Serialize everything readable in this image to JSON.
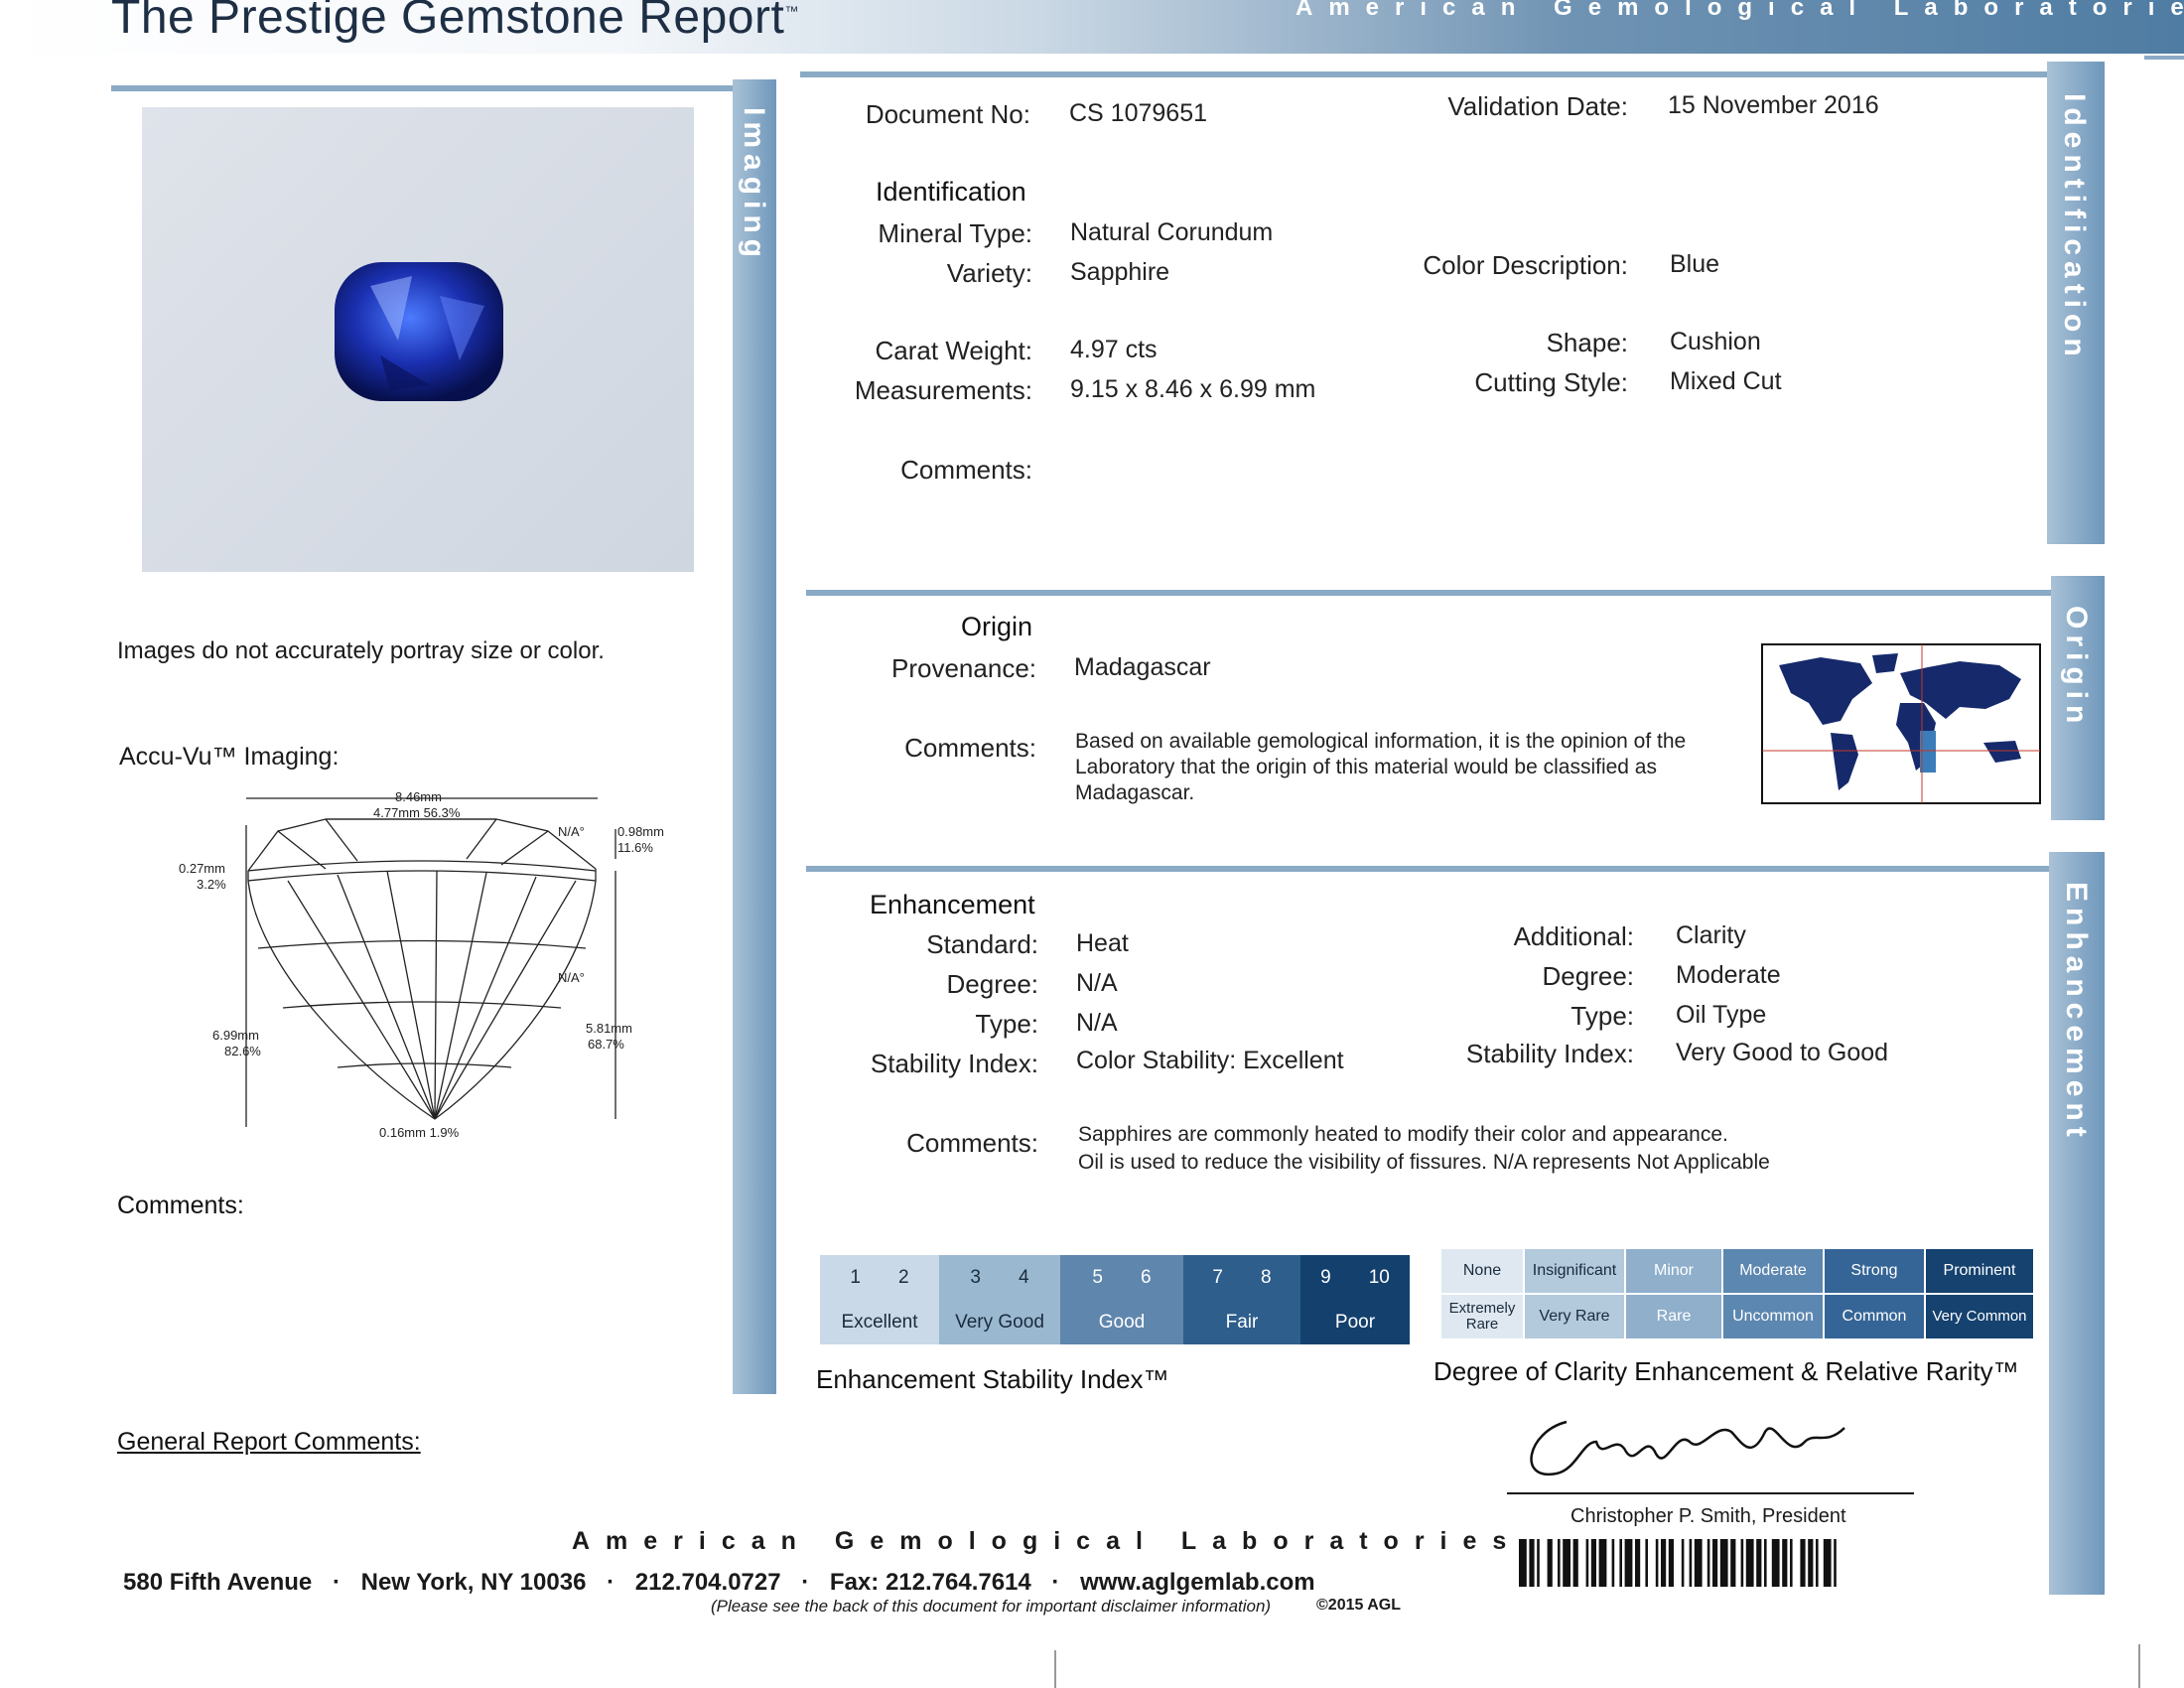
{
  "header": {
    "title": "The Prestige Gemstone Report",
    "title_mark": "™",
    "lab_name": "American Gemological Laboratories"
  },
  "imaging": {
    "tab_label": "Imaging",
    "image_note": "Images do not accurately portray size or color.",
    "accu_vu_label": "Accu-Vu™ Imaging:",
    "diagram": {
      "width": "8.46mm",
      "table": "4.77mm 56.3%",
      "crown_angle": "N/A°",
      "crown_height_mm": "0.98mm",
      "crown_height_pct": "11.6%",
      "girdle_mm": "0.27mm",
      "girdle_pct": "3.2%",
      "pavilion_angle": "N/A°",
      "depth_mm": "6.99mm",
      "depth_pct": "82.6%",
      "pavilion_depth_mm": "5.81mm",
      "pavilion_depth_pct": "68.7%",
      "culet": "0.16mm 1.9%"
    },
    "comments_label": "Comments:"
  },
  "identification": {
    "tab_label": "Identification",
    "document_no_label": "Document No:",
    "document_no": "CS 1079651",
    "validation_date_label": "Validation Date:",
    "validation_date": "15 November 2016",
    "section_title": "Identification",
    "mineral_type_label": "Mineral Type:",
    "mineral_type": "Natural Corundum",
    "variety_label": "Variety:",
    "variety": "Sapphire",
    "color_description_label": "Color Description:",
    "color_description": "Blue",
    "carat_weight_label": "Carat Weight:",
    "carat_weight": "4.97  cts",
    "shape_label": "Shape:",
    "shape": "Cushion",
    "measurements_label": "Measurements:",
    "measurements": "9.15 x 8.46 x 6.99  mm",
    "cutting_style_label": "Cutting Style:",
    "cutting_style": "Mixed Cut",
    "comments_label": "Comments:"
  },
  "origin": {
    "tab_label": "Origin",
    "section_title": "Origin",
    "provenance_label": "Provenance:",
    "provenance": "Madagascar",
    "comments_label": "Comments:",
    "comments": "Based on available gemological information, it is the opinion of the Laboratory that the origin of this material would be classified as Madagascar."
  },
  "enhancement": {
    "tab_label": "Enhancement",
    "section_title": "Enhancement",
    "standard_label": "Standard:",
    "standard": "Heat",
    "degree_label": "Degree:",
    "degree": "N/A",
    "type_label": "Type:",
    "type": "N/A",
    "stability_label": "Stability Index:",
    "stability": "Color Stability: Excellent",
    "additional_label": "Additional:",
    "additional": "Clarity",
    "add_degree_label": "Degree:",
    "add_degree": "Moderate",
    "add_type_label": "Type:",
    "add_type": "Oil Type",
    "add_stability_label": "Stability Index:",
    "add_stability": "Very Good to Good",
    "comments_label": "Comments:",
    "comments_line1": "Sapphires are commonly heated to modify their color and appearance.",
    "comments_line2": "Oil is used to reduce the visibility of fissures. N/A represents Not Applicable"
  },
  "stability_scale": {
    "title": "Enhancement Stability Index™",
    "numbers": [
      "1",
      "2",
      "3",
      "4",
      "5",
      "6",
      "7",
      "8",
      "9",
      "10"
    ],
    "grades": [
      "Excellent",
      "Very Good",
      "Good",
      "Fair",
      "Poor"
    ],
    "colors": [
      "#c9d9e7",
      "#9bb8d1",
      "#5f86ad",
      "#2e5e8c",
      "#14406e"
    ]
  },
  "clarity_scale": {
    "title": "Degree of Clarity Enhancement & Relative Rarity™",
    "degrees": [
      "None",
      "Insignificant",
      "Minor",
      "Moderate",
      "Strong",
      "Prominent"
    ],
    "rarity": [
      "Extremely Rare",
      "Very Rare",
      "Rare",
      "Uncommon",
      "Common",
      "Very Common"
    ],
    "colors": [
      "#dfe8f1",
      "#b3c9dc",
      "#8fafcb",
      "#5c87b0",
      "#356596",
      "#15426f"
    ]
  },
  "general": {
    "comments_label": "General Report Comments:"
  },
  "footer": {
    "lab_name": "American Gemological Laboratories",
    "address": "580 Fifth Avenue",
    "city": "New York, NY 10036",
    "phone": "212.704.0727",
    "fax": "Fax: 212.764.7614",
    "website": "www.aglgemlab.com",
    "disclaimer": "(Please see the back of this document for important disclaimer information)",
    "copyright": "©2015 AGL",
    "signatory": "Christopher P. Smith, President"
  }
}
